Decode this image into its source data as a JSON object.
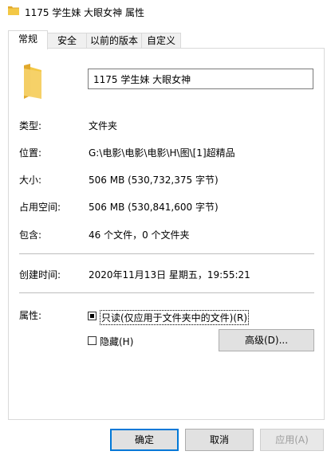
{
  "window": {
    "title": "1175 学生妹 大眼女神 属性",
    "icon": "folder-icon"
  },
  "tabs": [
    {
      "label": "常规",
      "active": true
    },
    {
      "label": "安全",
      "active": false
    },
    {
      "label": "以前的版本",
      "active": false
    },
    {
      "label": "自定义",
      "active": false
    }
  ],
  "general": {
    "folder_name": "1175 学生妹 大眼女神",
    "type_label": "类型:",
    "type_value": "文件夹",
    "location_label": "位置:",
    "location_value": "G:\\电影\\电影\\电影\\H\\图\\[1]超精品",
    "size_label": "大小:",
    "size_value": "506 MB (530,732,375 字节)",
    "disk_size_label": "占用空间:",
    "disk_size_value": "506 MB (530,841,600 字节)",
    "contains_label": "包含:",
    "contains_value": "46 个文件，0 个文件夹",
    "created_label": "创建时间:",
    "created_value": "2020年11月13日 星期五，19:55:21",
    "attributes_label": "属性:",
    "readonly_label": "只读(仅应用于文件夹中的文件)(R)",
    "readonly_state": "mixed",
    "hidden_label": "隐藏(H)",
    "hidden_checked": false,
    "advanced_button": "高级(D)..."
  },
  "footer": {
    "ok": "确定",
    "cancel": "取消",
    "apply": "应用(A)"
  },
  "colors": {
    "folder": "#f3c846",
    "folder_dark": "#e1a92c",
    "focus_border": "#0078d7"
  }
}
